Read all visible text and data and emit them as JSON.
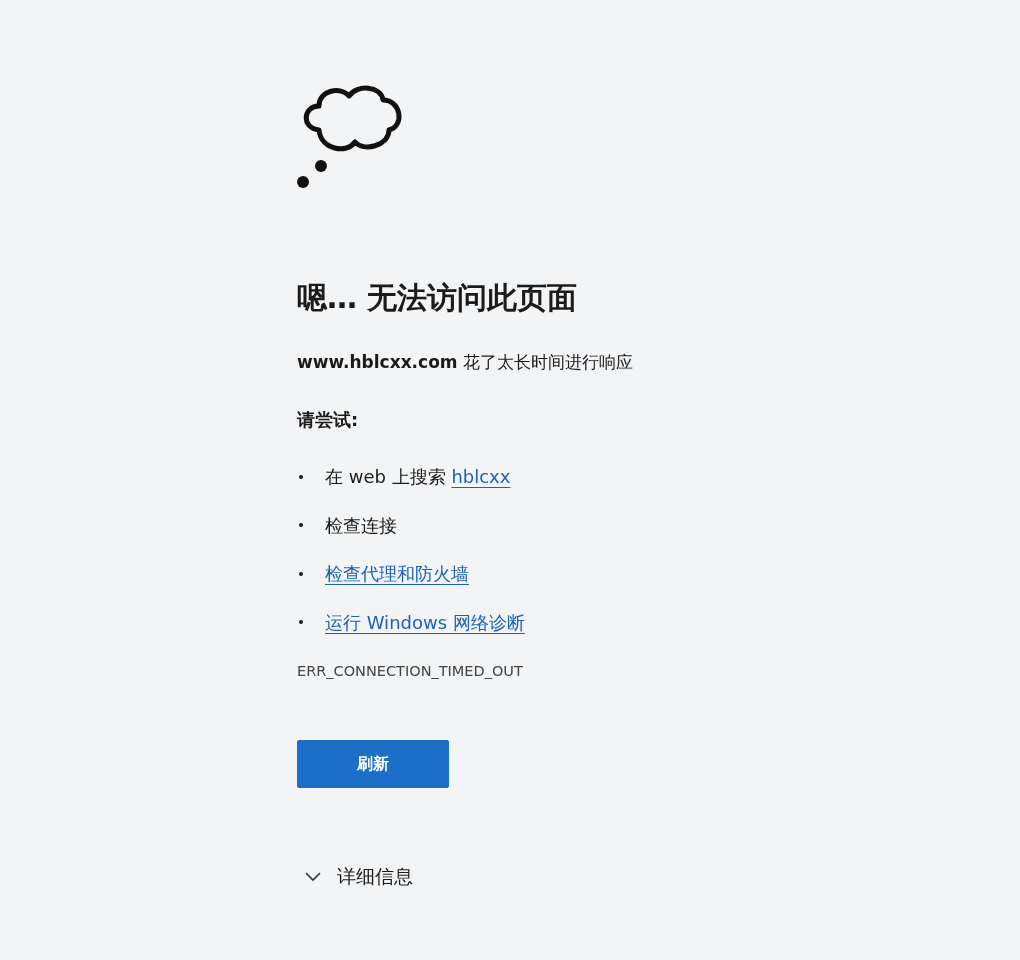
{
  "heading": "嗯… 无法访问此页面",
  "message": "**www.hblcxx.com** 花了太长时间进行响应",
  "try_label": "请尝试:",
  "suggestions": [
    {
      "kind": "search",
      "text": "在 web 上搜索 ",
      "link": "hblcxx"
    },
    {
      "kind": "plain",
      "text": "检查连接"
    },
    {
      "kind": "link",
      "link": "检查代理和防火墙"
    },
    {
      "kind": "link",
      "link": "运行 Windows 网络诊断"
    }
  ],
  "error_code": "ERR_CONNECTION_TIMED_OUT",
  "button": "刷新",
  "details": {
    "label": "详细信息",
    "expanded": false
  }
}
